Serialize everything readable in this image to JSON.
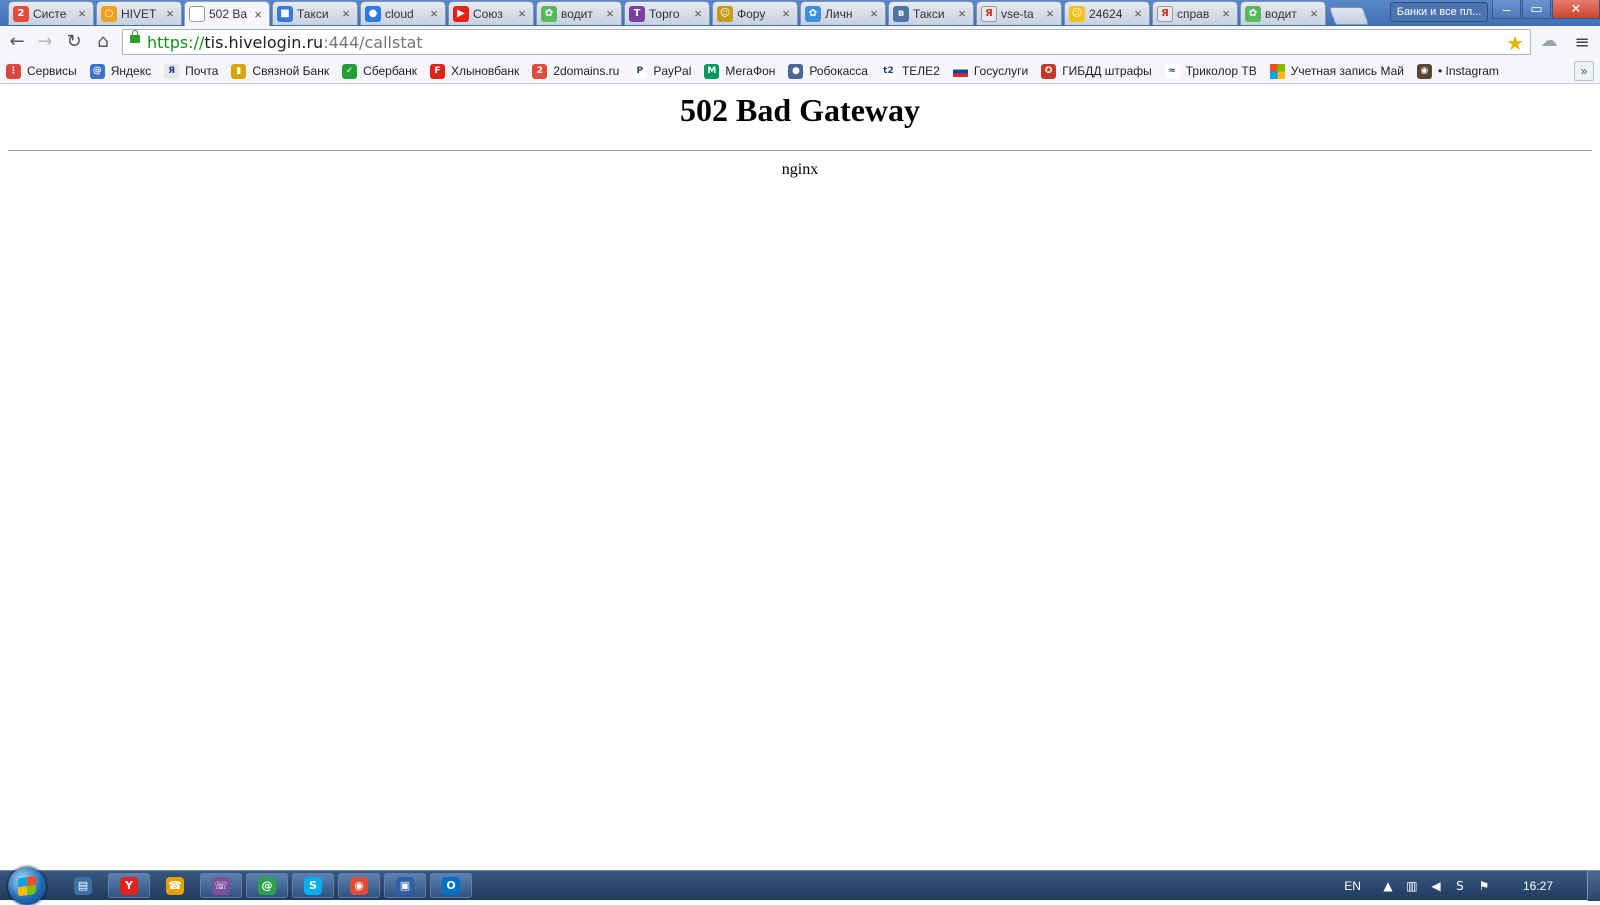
{
  "browser": {
    "tabs": [
      {
        "title": "Систе",
        "icon": "2gis-icon",
        "color": "#e34b3b",
        "glyph": "2"
      },
      {
        "title": "HIVET",
        "icon": "hive-icon",
        "color": "#f0a21f",
        "glyph": "○"
      },
      {
        "title": "502 Ba",
        "icon": "document-icon",
        "color": "#ffffff",
        "glyph": ""
      },
      {
        "title": "Такси",
        "icon": "tiles-icon",
        "color": "#3b78d8",
        "glyph": "■"
      },
      {
        "title": "cloud",
        "icon": "location-pin-icon",
        "color": "#2b7be4",
        "glyph": "●"
      },
      {
        "title": "Союз",
        "icon": "youtube-icon",
        "color": "#e62117",
        "glyph": "▶"
      },
      {
        "title": "водит",
        "icon": "green-dots-icon",
        "color": "#5cb85c",
        "glyph": "✿"
      },
      {
        "title": "Торго",
        "icon": "t-icon",
        "color": "#7a3fa0",
        "glyph": "T"
      },
      {
        "title": "Фору",
        "icon": "forum-icon",
        "color": "#c59a1b",
        "glyph": "☺"
      },
      {
        "title": "Личн",
        "icon": "people-icon",
        "color": "#3a8fd8",
        "glyph": "✿"
      },
      {
        "title": "Такси",
        "icon": "vk-icon",
        "color": "#4c75a3",
        "glyph": "в"
      },
      {
        "title": "vse-ta",
        "icon": "yandex-icon",
        "color": "#e8e8e8",
        "glyph": "Я"
      },
      {
        "title": "24624",
        "icon": "smile-icon",
        "color": "#f2c019",
        "glyph": "☺"
      },
      {
        "title": "справ",
        "icon": "yandex-icon",
        "color": "#e8e8e8",
        "glyph": "Я"
      },
      {
        "title": "водит",
        "icon": "green-dots-icon",
        "color": "#5cb85c",
        "glyph": "✿"
      }
    ],
    "active_tab": 2,
    "tab_close_glyph": "×",
    "profile_label": "Банки и все пл...",
    "window_controls": {
      "minimize": "–",
      "maximize": "▭",
      "close": "✕"
    },
    "nav": {
      "back": "←",
      "forward": "→",
      "reload": "↻",
      "home": "⌂"
    },
    "url": {
      "protocol": "https://",
      "host": "tis.hivelogin.ru",
      "rest": ":444/callstat"
    },
    "star_glyph": "★",
    "extension_glyph": "☁",
    "menu_glyph": "≡",
    "bookmarks": [
      {
        "label": "Сервисы",
        "icon": "apps-grid-icon",
        "color": "#d9463b",
        "glyph": "⋮"
      },
      {
        "label": "Яндекс",
        "icon": "yandex-icon",
        "color": "#3f73c9",
        "glyph": "@"
      },
      {
        "label": "Почта",
        "icon": "yandex-icon",
        "color": "#e8e8e8",
        "glyph": "Я"
      },
      {
        "label": "Связной Банк",
        "icon": "bank-icon",
        "color": "#d8a500",
        "glyph": "▮"
      },
      {
        "label": "Сбербанк",
        "icon": "sberbank-icon",
        "color": "#21a038",
        "glyph": "✓"
      },
      {
        "label": "Хлыновбанк",
        "icon": "bank-icon",
        "color": "#e2231a",
        "glyph": "F"
      },
      {
        "label": "2domains.ru",
        "icon": "2domains-icon",
        "color": "#e34b3b",
        "glyph": "2"
      },
      {
        "label": "PayPal",
        "icon": "paypal-icon",
        "color": "#ffffff",
        "glyph": "P"
      },
      {
        "label": "МегаФон",
        "icon": "megafon-icon",
        "color": "#00985f",
        "glyph": "М"
      },
      {
        "label": "Робокасса",
        "icon": "person-icon",
        "color": "#4a6a95",
        "glyph": "●"
      },
      {
        "label": "ТЕЛЕ2",
        "icon": "tele2-icon",
        "color": "#ffffff",
        "glyph": "t2"
      },
      {
        "label": "Госуслуги",
        "icon": "russia-flag-icon",
        "color": "#ffffff",
        "glyph": ""
      },
      {
        "label": "ГИБДД штрафы",
        "icon": "emblem-icon",
        "color": "#c0392b",
        "glyph": "✪"
      },
      {
        "label": "Триколор ТВ",
        "icon": "tricolor-icon",
        "color": "#ffffff",
        "glyph": "≈"
      },
      {
        "label": "Учетная запись Май",
        "icon": "microsoft-icon",
        "color": "#ffffff",
        "glyph": ""
      },
      {
        "label": "• Instagram",
        "icon": "instagram-icon",
        "color": "#5a4636",
        "glyph": "◉"
      }
    ],
    "bookmarks_more": "»"
  },
  "page": {
    "heading": "502 Bad Gateway",
    "server": "nginx"
  },
  "taskbar": {
    "apps": [
      {
        "name": "explorer-icon",
        "color": "#3f6fa8",
        "glyph": "▤",
        "plain": true
      },
      {
        "name": "yandex-browser-icon",
        "color": "#e2231a",
        "glyph": "Y"
      },
      {
        "name": "phone-icon",
        "color": "#e9a200",
        "glyph": "☎",
        "plain": true
      },
      {
        "name": "viber-icon",
        "color": "#7b519d",
        "glyph": "☏"
      },
      {
        "name": "messenger-icon",
        "color": "#2ea14b",
        "glyph": "@"
      },
      {
        "name": "skype-icon",
        "color": "#00aff0",
        "glyph": "S"
      },
      {
        "name": "chrome-icon",
        "color": "#dd4b39",
        "glyph": "◉"
      },
      {
        "name": "save-disk-icon",
        "color": "#2f5fa6",
        "glyph": "▣"
      },
      {
        "name": "outlook-icon",
        "color": "#0072c6",
        "glyph": "O"
      }
    ],
    "language": "EN",
    "tray_icons": [
      {
        "name": "show-hidden-icon",
        "glyph": "▲"
      },
      {
        "name": "network-icon",
        "glyph": "▥"
      },
      {
        "name": "volume-icon",
        "glyph": "◀"
      },
      {
        "name": "skype-tray-icon",
        "glyph": "S"
      },
      {
        "name": "flag-alert-icon",
        "glyph": "⚑"
      }
    ],
    "clock": "16:27"
  }
}
